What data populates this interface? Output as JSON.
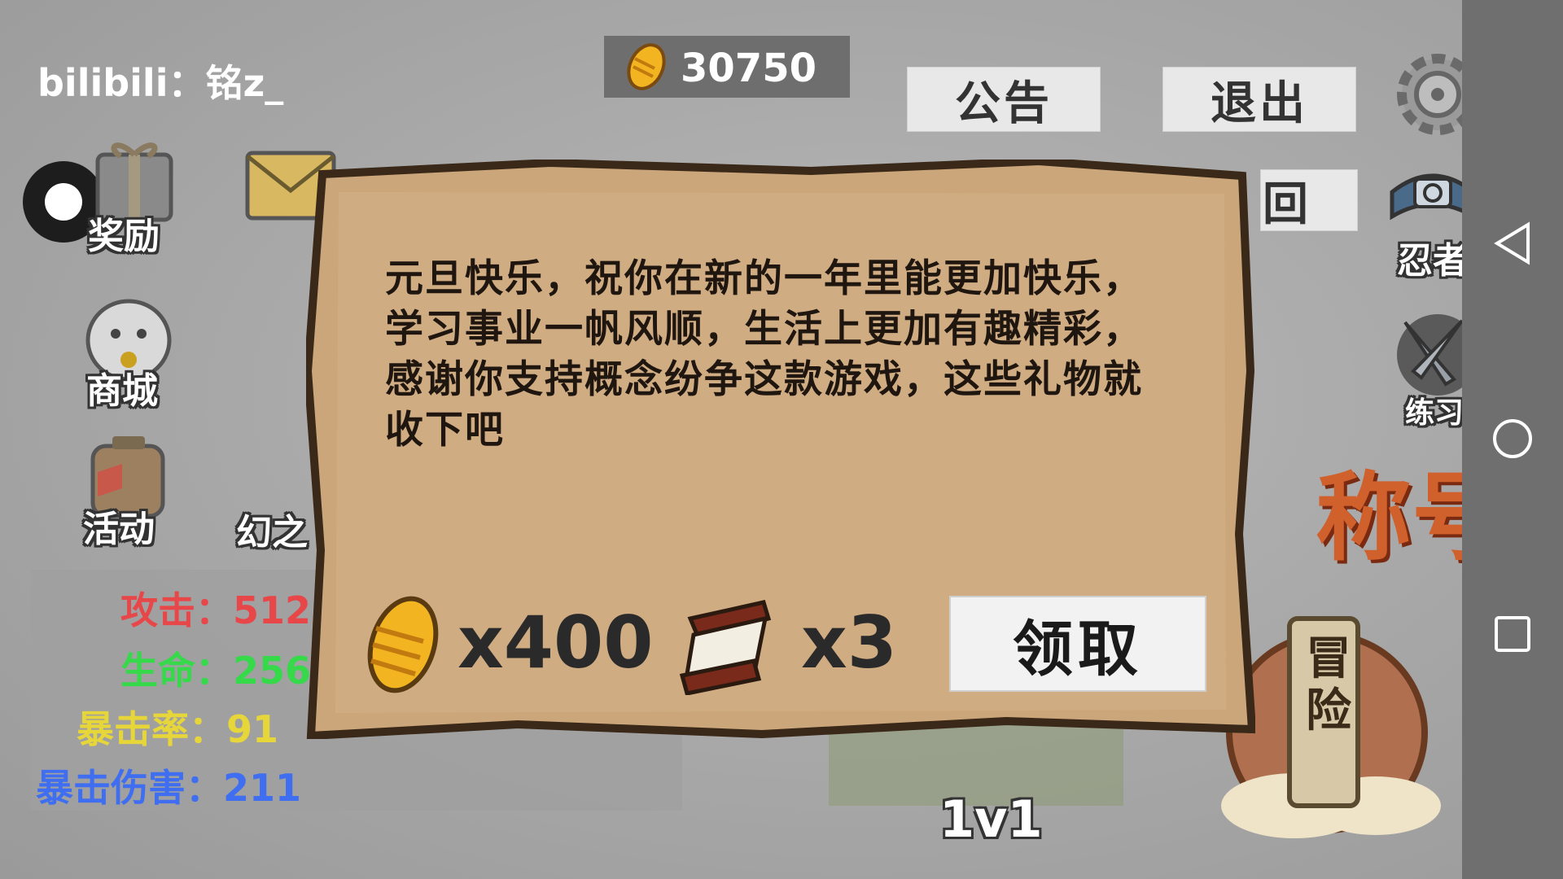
{
  "header": {
    "username": "bilibili：铭z_",
    "coins": "30750",
    "announcement_label": "公告",
    "exit_label": "退出",
    "back_label_partial": "回"
  },
  "left_menu": {
    "reward_label": "奖励",
    "shop_label": "商城",
    "activity_label": "活动",
    "fantasy_label_partial": "幻之"
  },
  "right_menu": {
    "ninja_label": "忍者",
    "practice_label": "练习",
    "title_label": "称号",
    "adventure_label": "冒险"
  },
  "stats": {
    "attack": "攻击：512",
    "health": "生命：256",
    "crit_rate": "暴击率：91",
    "crit_damage": "暴击伤害：211"
  },
  "colors": {
    "attack": "#e8474a",
    "health": "#35d94a",
    "crit_rate": "#e6d63a",
    "crit_damage": "#3f6ff0",
    "parchment": "#caa67a"
  },
  "modal": {
    "message": "元旦快乐，祝你在新的一年里能更加快乐，学习事业一帆风顺，生活上更加有趣精彩，感谢你支持概念纷争这款游戏，这些礼物就收下吧",
    "reward1_count": "x400",
    "reward2_count": "x3",
    "claim_label": "领取"
  },
  "bottom": {
    "mode_label": "1v1"
  },
  "icons": [
    "coin-icon",
    "gear-icon",
    "gift-icon",
    "mail-icon",
    "lucky-cat-icon",
    "lantern-icon",
    "ninja-headband-icon",
    "kunai-icon",
    "scroll-icon",
    "back-triangle-icon",
    "home-circle-icon",
    "recent-square-icon"
  ]
}
